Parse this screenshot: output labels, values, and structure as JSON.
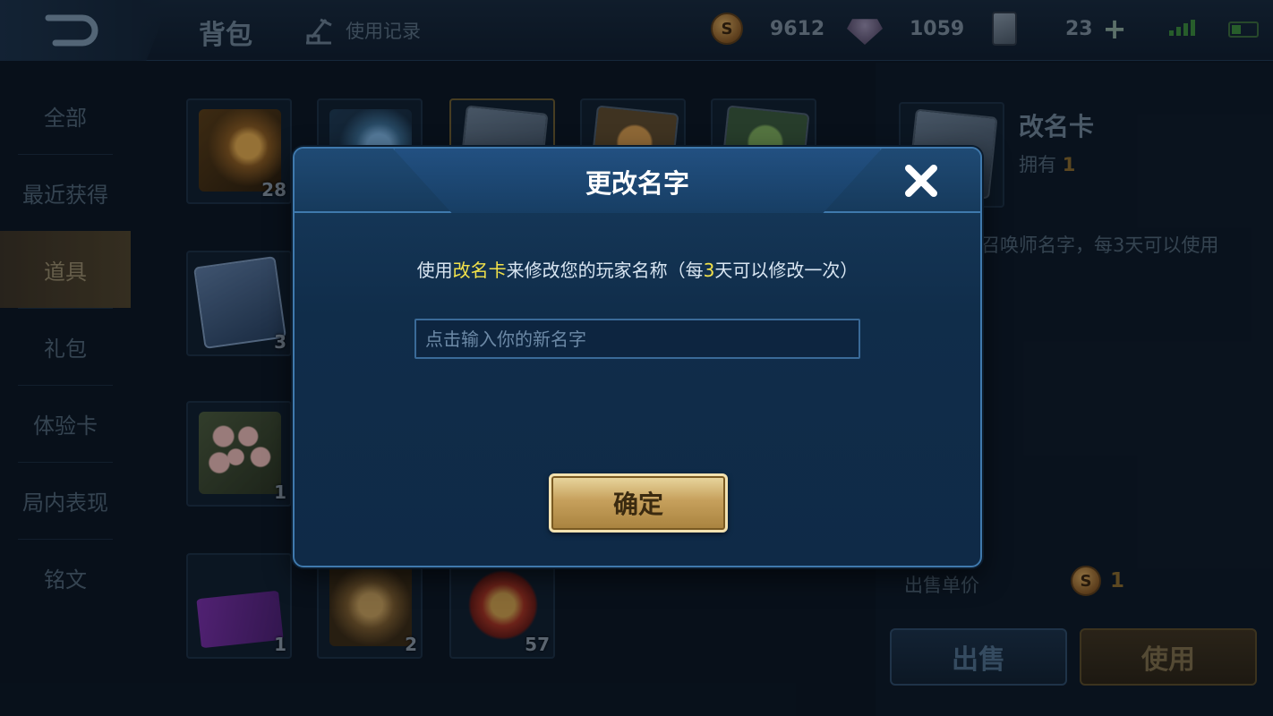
{
  "topbar": {
    "title": "背包",
    "history_label": "使用记录",
    "gold": "9612",
    "gems": "1059",
    "cards": "23"
  },
  "sidenav": {
    "items": [
      {
        "label": "全部"
      },
      {
        "label": "最近获得"
      },
      {
        "label": "道具",
        "active": true
      },
      {
        "label": "礼包"
      },
      {
        "label": "体验卡"
      },
      {
        "label": "局内表现"
      },
      {
        "label": "铭文"
      }
    ]
  },
  "grid": {
    "items": [
      {
        "name": "megaphone-gold",
        "count": "28"
      },
      {
        "name": "megaphone-blue",
        "count": ""
      },
      {
        "name": "rename-card",
        "count": "",
        "selected": true
      },
      {
        "name": "gold-card",
        "count": ""
      },
      {
        "name": "exp-card",
        "count": ""
      },
      {
        "name": "exp-x2-card",
        "count": "3"
      },
      {
        "name": "flower-bouquet",
        "count": "1"
      },
      {
        "name": "ticket-30",
        "count": "1"
      },
      {
        "name": "badge",
        "count": "2"
      },
      {
        "name": "star-medal",
        "count": "57"
      }
    ]
  },
  "detail": {
    "name": "改名卡",
    "own_label": "拥有",
    "own_value": "1",
    "description_visible": "召唤师名字，每3天可以使用",
    "price_label": "出售单价",
    "price_value": "1",
    "sell_label": "出售",
    "use_label": "使用"
  },
  "dialog": {
    "title": "更改名字",
    "instruction_pre": "使用",
    "instruction_hl1": "改名卡",
    "instruction_mid": "来修改您的玩家名称（每",
    "instruction_hl2": "3",
    "instruction_post": "天可以修改一次）",
    "input_placeholder": "点击输入你的新名字",
    "input_value": "",
    "confirm_label": "确定"
  },
  "colors": {
    "highlight": "#f3e24a",
    "dialog_border": "#3f79ad",
    "confirm_gold": "#c6a05c"
  }
}
